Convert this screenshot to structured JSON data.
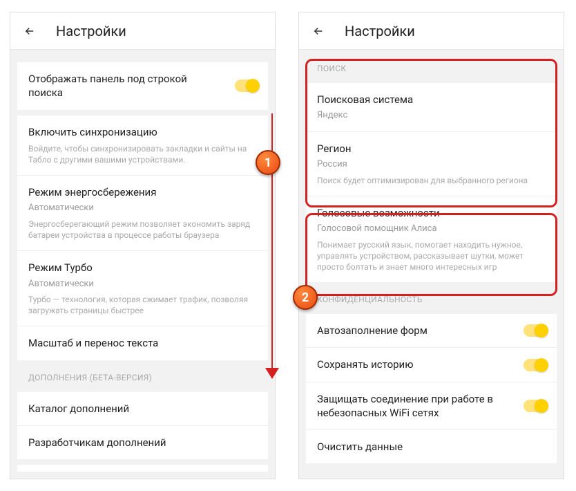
{
  "left": {
    "header": {
      "title": "Настройки"
    },
    "toggleRow": {
      "title": "Отображать панель под строкой поиска"
    },
    "sync": {
      "title": "Включить синхронизацию",
      "desc": "Войдите, чтобы синхронизировать закладки и сайты на Табло с другими вашими устройствами."
    },
    "power": {
      "title": "Режим энергосбережения",
      "sub": "Автоматически",
      "desc": "Энергосберегающий режим позволяет экономить заряд батареи устройства в процессе работы браузера"
    },
    "turbo": {
      "title": "Режим Турбо",
      "sub": "Автоматически",
      "desc": "Турбо — технология, которая сжимает трафик, позволяя загружать страницы быстрее"
    },
    "scale": {
      "title": "Масштаб и перенос текста"
    },
    "extSection": "ДОПОЛНЕНИЯ (БЕТА-ВЕРСИЯ)",
    "catalog": {
      "title": "Каталог дополнений"
    },
    "devs": {
      "title": "Разработчикам дополнений"
    }
  },
  "right": {
    "header": {
      "title": "Настройки"
    },
    "searchSection": "ПОИСК",
    "engine": {
      "title": "Поисковая система",
      "sub": "Яндекс"
    },
    "region": {
      "title": "Регион",
      "sub": "Россия",
      "desc": "Поиск будет оптимизирован для выбранного региона"
    },
    "voice": {
      "title": "Голосовые возможности",
      "sub": "Голосовой помощник Алиса",
      "desc": "Понимает русский язык, помогает находить нужное, управлять устройством, рассказывает шутки, может просто болтать и знает много интересных игр"
    },
    "privacySection": "КОНФИДЕНЦИАЛЬНОСТЬ",
    "autofill": {
      "title": "Автозаполнение форм"
    },
    "history": {
      "title": "Сохранять историю"
    },
    "protect": {
      "title": "Защищать соединение при работе в небезопасных WiFi сетях"
    },
    "clear": {
      "title": "Очистить данные"
    }
  },
  "markers": {
    "one": "1",
    "two": "2"
  }
}
